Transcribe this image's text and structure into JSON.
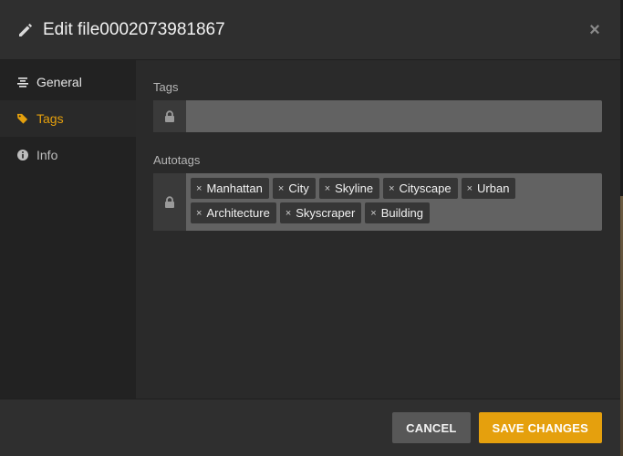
{
  "dialog": {
    "title": "Edit file0002073981867",
    "close_glyph": "×"
  },
  "sidebar": {
    "items": [
      {
        "label": "General",
        "icon": "align-center-icon",
        "active": false
      },
      {
        "label": "Tags",
        "icon": "tag-icon",
        "active": true
      },
      {
        "label": "Info",
        "icon": "info-icon",
        "active": false
      }
    ]
  },
  "tags_field": {
    "label": "Tags",
    "value": ""
  },
  "autotags_field": {
    "label": "Autotags",
    "tags": [
      "Manhattan",
      "City",
      "Skyline",
      "Cityscape",
      "Urban",
      "Architecture",
      "Skyscraper",
      "Building"
    ]
  },
  "footer": {
    "cancel_label": "CANCEL",
    "save_label": "SAVE CHANGES"
  },
  "colors": {
    "accent": "#e5a00d",
    "background": "#2a2a2a"
  }
}
